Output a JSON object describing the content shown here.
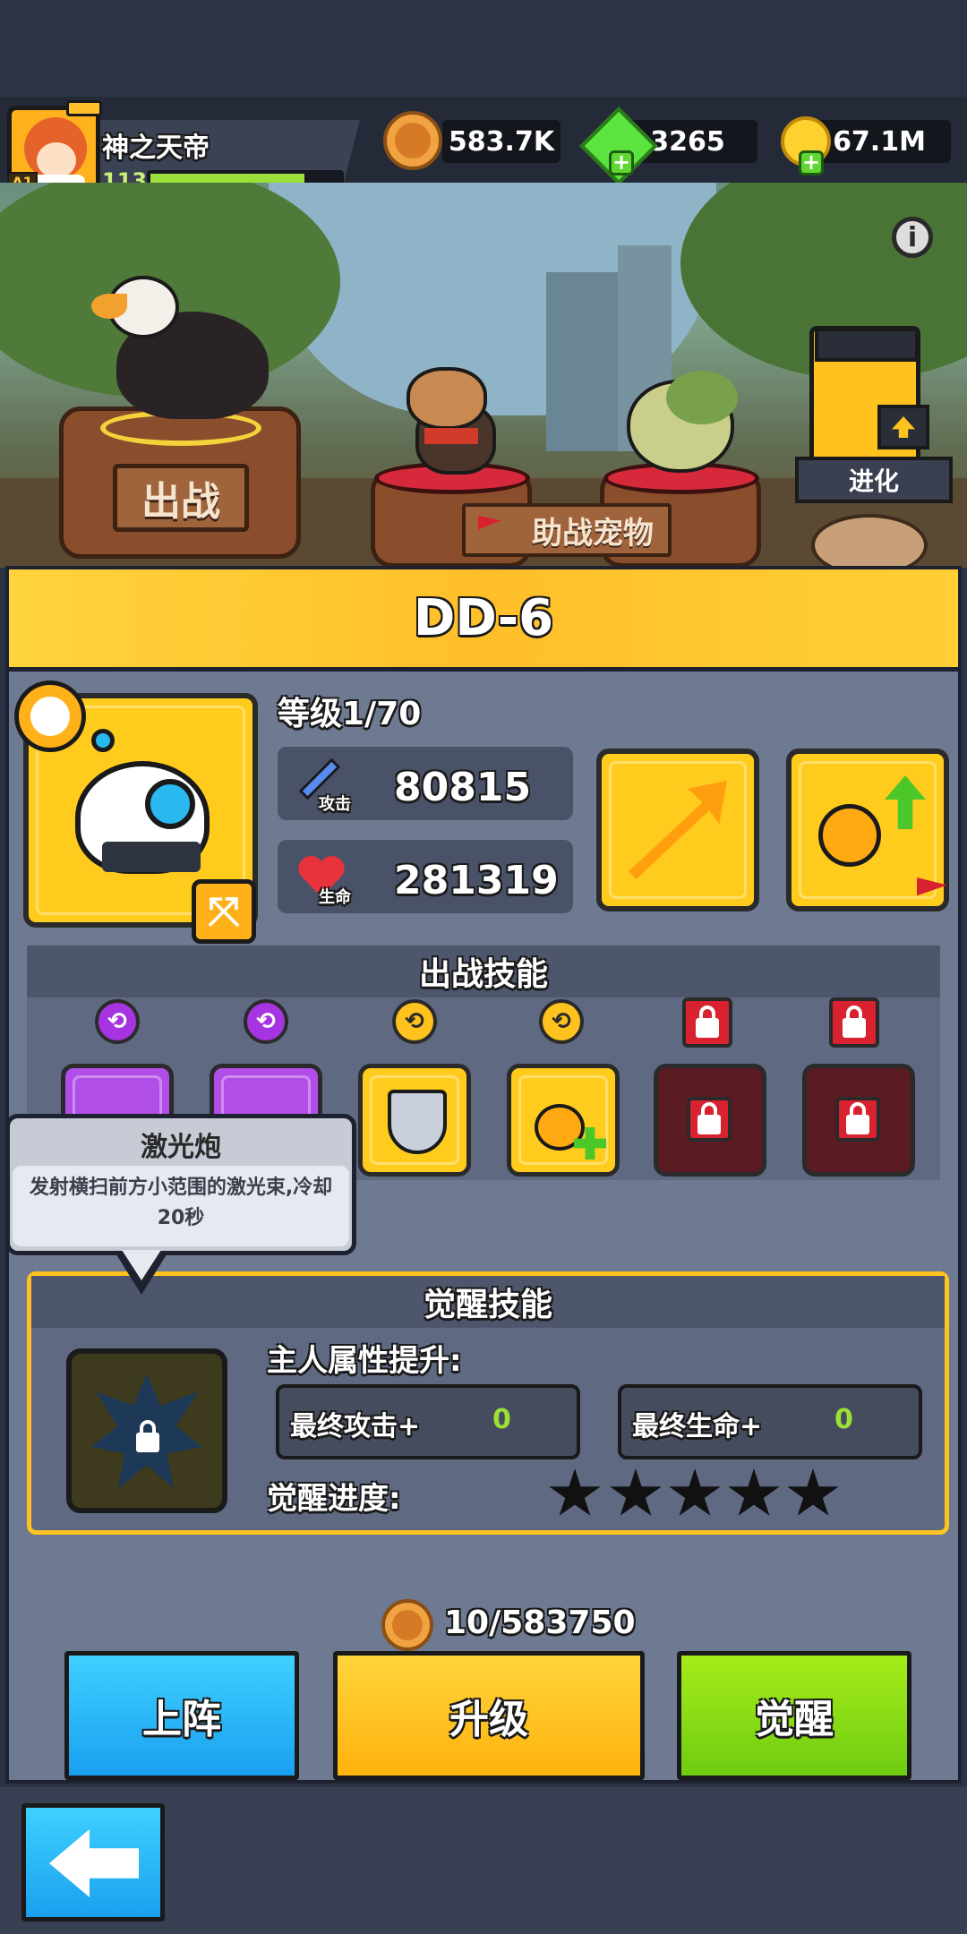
{
  "player": {
    "name": "神之天帝",
    "level": "113",
    "avatar_badge": "A1",
    "xp_progress": 0.85
  },
  "resources": [
    {
      "icon": "paw-coin-icon",
      "value": "583.7K",
      "has_add": false
    },
    {
      "icon": "green-gem-icon",
      "value": "3265",
      "has_add": true
    },
    {
      "icon": "gold-coin-icon",
      "value": "67.1M",
      "has_add": true
    }
  ],
  "scene": {
    "deploy_label": "出战",
    "assist_label": "助战宠物",
    "evolve_label": "进化",
    "info_icon": "info-icon"
  },
  "pet": {
    "name": "DD-6",
    "level_text": "等级1/70",
    "attack_tag": "攻击",
    "attack_value": "80815",
    "hp_tag": "生命",
    "hp_value": "281319"
  },
  "battle_skills": {
    "title": "出战技能",
    "badges": [
      "purple",
      "purple",
      "yellow",
      "yellow",
      "locked",
      "locked"
    ]
  },
  "tooltip": {
    "title": "激光炮",
    "desc": "发射横扫前方小范围的激光束,冷却20秒"
  },
  "awaken": {
    "title": "觉醒技能",
    "owner_boost": "主人属性提升:",
    "final_attack_label": "最终攻击+",
    "final_attack_value": "0",
    "final_hp_label": "最终生命+",
    "final_hp_value": "0",
    "progress_label": "觉醒进度:",
    "stars_filled": 0,
    "stars_total": 5
  },
  "cost": {
    "text": "10/583750",
    "icon": "paw-coin-icon"
  },
  "buttons": {
    "deploy": "上阵",
    "upgrade": "升级",
    "awaken": "觉醒"
  },
  "colors": {
    "yellow": "#ffcc1e",
    "blue": "#1fb3f5",
    "green": "#7fd21a",
    "purple": "#b24ee8"
  }
}
